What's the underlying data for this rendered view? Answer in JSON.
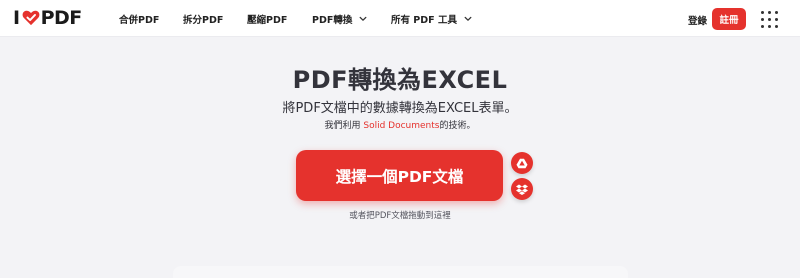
{
  "header": {
    "logo_prefix": "I",
    "logo_suffix": "PDF",
    "nav": [
      {
        "label": "合併PDF"
      },
      {
        "label": "拆分PDF"
      },
      {
        "label": "壓縮PDF"
      },
      {
        "label": "PDF轉換"
      },
      {
        "label": "所有 PDF 工具"
      }
    ],
    "login_label": "登錄",
    "signup_label": "註冊"
  },
  "main": {
    "title": "PDF轉換為EXCEL",
    "subtitle": "將PDF文檔中的數據轉換為EXCEL表單。",
    "credit_prefix": "我們利用 ",
    "credit_link": "Solid Documents",
    "credit_suffix": "的技術。",
    "select_button_label": "選擇一個PDF文檔",
    "drop_hint": "或者把PDF文檔拖動到這裡"
  },
  "colors": {
    "accent": "#e5322d",
    "background": "#f3f3f6",
    "header_bg": "#ffffff",
    "text": "#33333b"
  },
  "icons": {
    "logo_heart": "heart-check-icon",
    "google_drive": "google-drive-icon",
    "dropbox": "dropbox-icon",
    "apps_menu": "grid-dots-icon",
    "dropdown": "chevron-down-icon"
  }
}
